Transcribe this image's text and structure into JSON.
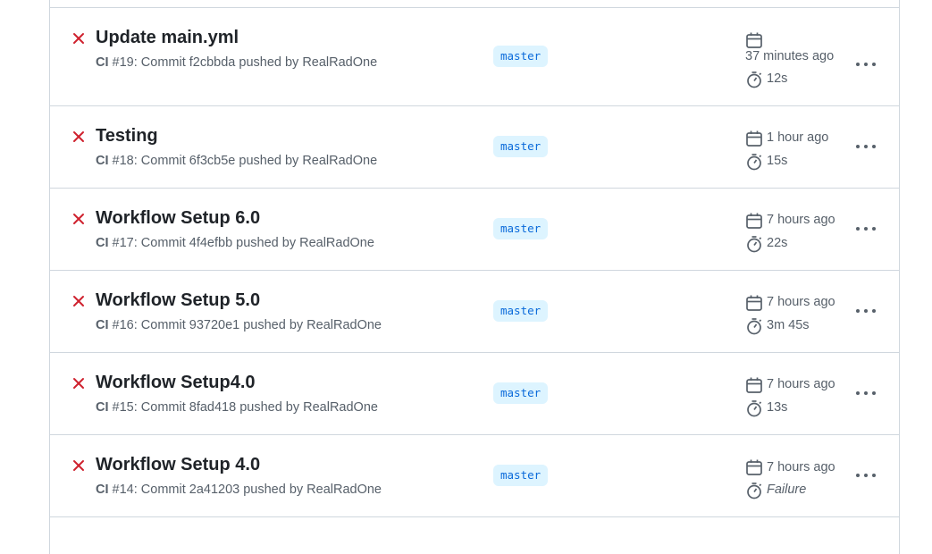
{
  "runs": [
    {
      "title": "Update main.yml",
      "workflow": "CI",
      "run_info": "#19: Commit f2cbbda pushed by RealRadOne",
      "branch": "master",
      "time_ago": "37 minutes ago",
      "duration": "12s",
      "status": "failure"
    },
    {
      "title": "Testing",
      "workflow": "CI",
      "run_info": "#18: Commit 6f3cb5e pushed by RealRadOne",
      "branch": "master",
      "time_ago": "1 hour ago",
      "duration": "15s",
      "status": "failure"
    },
    {
      "title": "Workflow Setup 6.0",
      "workflow": "CI",
      "run_info": "#17: Commit 4f4efbb pushed by RealRadOne",
      "branch": "master",
      "time_ago": "7 hours ago",
      "duration": "22s",
      "status": "failure"
    },
    {
      "title": "Workflow Setup 5.0",
      "workflow": "CI",
      "run_info": "#16: Commit 93720e1 pushed by RealRadOne",
      "branch": "master",
      "time_ago": "7 hours ago",
      "duration": "3m 45s",
      "status": "failure"
    },
    {
      "title": "Workflow Setup4.0",
      "workflow": "CI",
      "run_info": "#15: Commit 8fad418 pushed by RealRadOne",
      "branch": "master",
      "time_ago": "7 hours ago",
      "duration": "13s",
      "status": "failure"
    },
    {
      "title": "Workflow Setup 4.0",
      "workflow": "CI",
      "run_info": "#14: Commit 2a41203 pushed by RealRadOne",
      "branch": "master",
      "time_ago": "7 hours ago",
      "duration": "Failure",
      "status": "failure"
    }
  ],
  "colors": {
    "failure": "#cf222e",
    "branch_bg": "#ddf4ff",
    "branch_text": "#0969da",
    "muted": "#57606a",
    "border": "#d0d7de"
  },
  "icons": {
    "status": "x-icon",
    "date": "calendar-icon",
    "duration": "stopwatch-icon",
    "menu": "kebab-horizontal-icon"
  }
}
